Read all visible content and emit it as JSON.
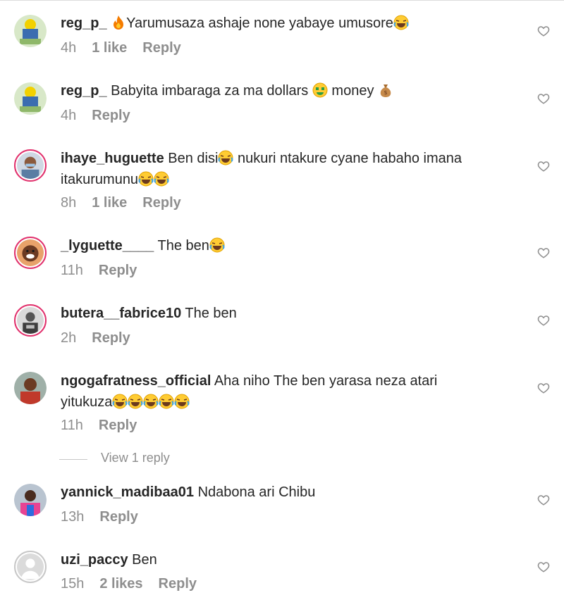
{
  "comments": [
    {
      "username": "reg_p_",
      "pre": "",
      "text": "Yarumusaza ashaje none yabaye umusore",
      "time": "4h",
      "likes": "1 like",
      "reply": "Reply"
    },
    {
      "username": "reg_p_",
      "pre": "",
      "text": "Babyita imbaraga za ma dollars",
      "text2": "money",
      "time": "4h",
      "likes": "",
      "reply": "Reply"
    },
    {
      "username": "ihaye_huguette",
      "text": "Ben disi",
      "text2": "nukuri ntakure cyane habaho imana",
      "text3": "itakurumunu",
      "time": "8h",
      "likes": "1 like",
      "reply": "Reply"
    },
    {
      "username": "_lyguette____",
      "text": "The ben",
      "time": "11h",
      "likes": "",
      "reply": "Reply"
    },
    {
      "username": "butera__fabrice10",
      "text": "The ben",
      "time": "2h",
      "likes": "",
      "reply": "Reply"
    },
    {
      "username": "ngogafratness_official",
      "text": "Aha niho The ben yarasa neza atari",
      "text2": "yitukuza",
      "time": "11h",
      "likes": "",
      "reply": "Reply"
    },
    {
      "username": "yannick_madibaa01",
      "text": "Ndabona ari Chibu",
      "time": "13h",
      "likes": "",
      "reply": "Reply"
    },
    {
      "username": "uzi_paccy",
      "text": "Ben",
      "time": "15h",
      "likes": "2 likes",
      "reply": "Reply"
    }
  ],
  "view_replies_label": "View 1 reply",
  "icons": {
    "heart": "heart-outline-icon",
    "emoji_laugh": "face-with-tears-of-joy",
    "emoji_fire": "fire",
    "emoji_money_face": "money-mouth-face",
    "emoji_money_bag": "money-bag"
  },
  "colors": {
    "text": "#262626",
    "meta": "#8e8e8e",
    "story_ring": "#e1306c"
  }
}
